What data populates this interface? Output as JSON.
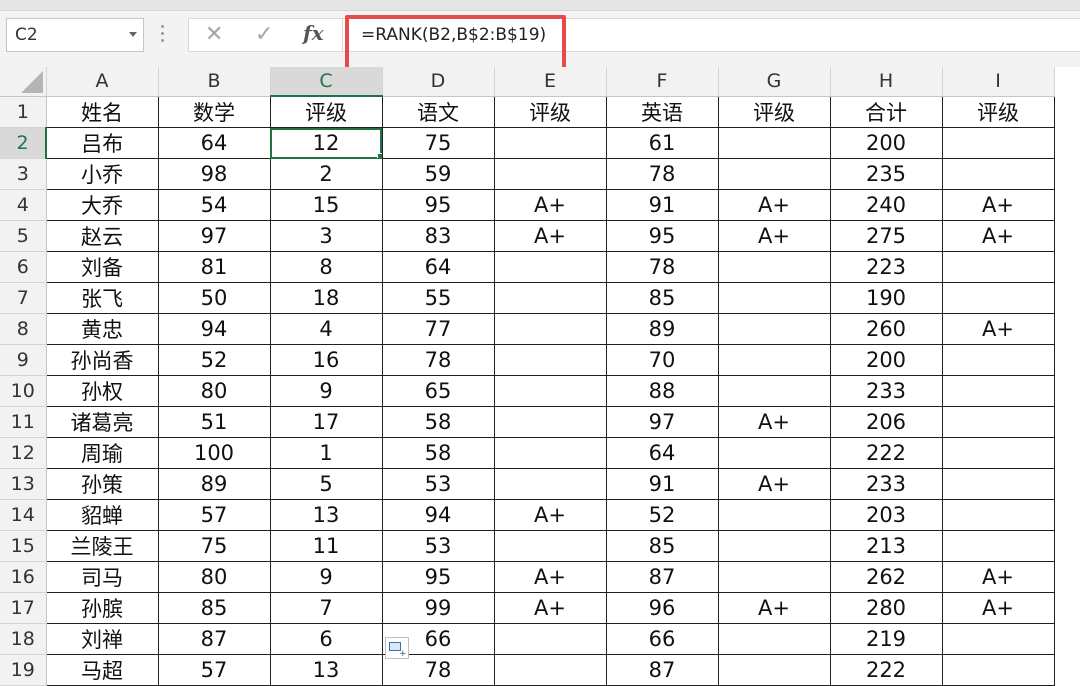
{
  "name_box": {
    "value": "C2"
  },
  "formula_bar": {
    "fx_label": "fx",
    "cancel_glyph": "✕",
    "enter_glyph": "✓",
    "formula": "=RANK(B2,B$2:B$19)"
  },
  "selected_cell": "C2",
  "columns": [
    "A",
    "B",
    "C",
    "D",
    "E",
    "F",
    "G",
    "H",
    "I"
  ],
  "rows": [
    [
      "姓名",
      "数学",
      "评级",
      "语文",
      "评级",
      "英语",
      "评级",
      "合计",
      "评级"
    ],
    [
      "吕布",
      "64",
      "12",
      "75",
      "",
      "61",
      "",
      "200",
      ""
    ],
    [
      "小乔",
      "98",
      "2",
      "59",
      "",
      "78",
      "",
      "235",
      ""
    ],
    [
      "大乔",
      "54",
      "15",
      "95",
      "A+",
      "91",
      "A+",
      "240",
      "A+"
    ],
    [
      "赵云",
      "97",
      "3",
      "83",
      "A+",
      "95",
      "A+",
      "275",
      "A+"
    ],
    [
      "刘备",
      "81",
      "8",
      "64",
      "",
      "78",
      "",
      "223",
      ""
    ],
    [
      "张飞",
      "50",
      "18",
      "55",
      "",
      "85",
      "",
      "190",
      ""
    ],
    [
      "黄忠",
      "94",
      "4",
      "77",
      "",
      "89",
      "",
      "260",
      "A+"
    ],
    [
      "孙尚香",
      "52",
      "16",
      "78",
      "",
      "70",
      "",
      "200",
      ""
    ],
    [
      "孙权",
      "80",
      "9",
      "65",
      "",
      "88",
      "",
      "233",
      ""
    ],
    [
      "诸葛亮",
      "51",
      "17",
      "58",
      "",
      "97",
      "A+",
      "206",
      ""
    ],
    [
      "周瑜",
      "100",
      "1",
      "58",
      "",
      "64",
      "",
      "222",
      ""
    ],
    [
      "孙策",
      "89",
      "5",
      "53",
      "",
      "91",
      "A+",
      "233",
      ""
    ],
    [
      "貂蝉",
      "57",
      "13",
      "94",
      "A+",
      "52",
      "",
      "203",
      ""
    ],
    [
      "兰陵王",
      "75",
      "11",
      "53",
      "",
      "85",
      "",
      "213",
      ""
    ],
    [
      "司马",
      "80",
      "9",
      "95",
      "A+",
      "87",
      "",
      "262",
      "A+"
    ],
    [
      "孙膑",
      "85",
      "7",
      "99",
      "A+",
      "96",
      "A+",
      "280",
      "A+"
    ],
    [
      "刘禅",
      "87",
      "6",
      "66",
      "",
      "66",
      "",
      "219",
      ""
    ],
    [
      "马超",
      "57",
      "13",
      "78",
      "",
      "87",
      "",
      "222",
      ""
    ]
  ],
  "colors": {
    "selection_accent": "#217346",
    "highlight_box": "#e74a4a",
    "header_bg": "#f2f2f2"
  }
}
